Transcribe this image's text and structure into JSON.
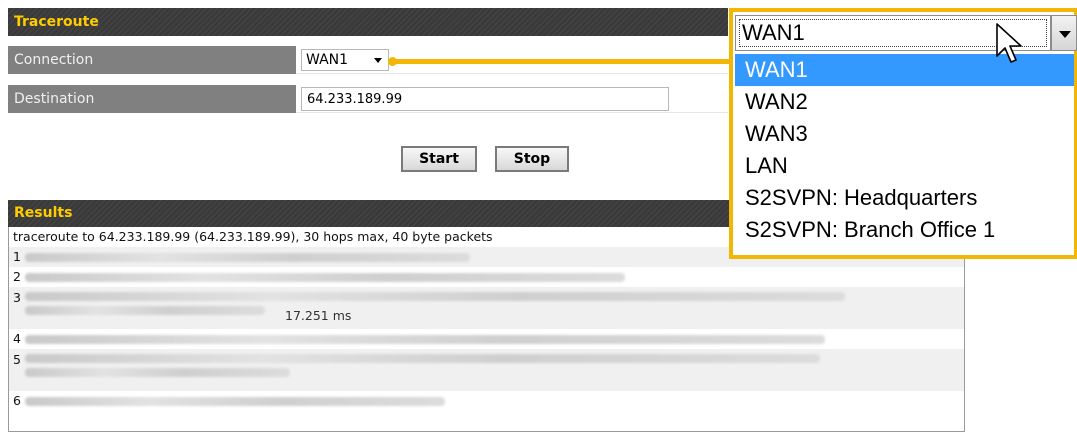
{
  "traceroute": {
    "title": "Traceroute",
    "connection_label": "Connection",
    "connection_value": "WAN1",
    "destination_label": "Destination",
    "destination_value": "64.233.189.99",
    "start_label": "Start",
    "stop_label": "Stop"
  },
  "results": {
    "title": "Results",
    "header_line": "traceroute to 64.233.189.99 (64.233.189.99), 30 hops max, 40 byte packets",
    "hops": [
      {
        "num": "1",
        "tail": ""
      },
      {
        "num": "2",
        "tail": ""
      },
      {
        "num": "3",
        "tail": "17.251 ms"
      },
      {
        "num": "4",
        "tail": ""
      },
      {
        "num": "5",
        "tail": ""
      },
      {
        "num": "6",
        "tail": ""
      }
    ]
  },
  "dropdown": {
    "current": "WAN1",
    "options": [
      "WAN1",
      "WAN2",
      "WAN3",
      "LAN",
      "S2SVPN: Headquarters",
      "S2SVPN: Branch Office 1"
    ],
    "selected_index": 0
  },
  "colors": {
    "accent": "#f2b705",
    "title_text": "#ffcc00",
    "selection": "#3399ff",
    "label_bg": "#808080"
  },
  "icons": [
    "dropdown-arrow-icon",
    "mouse-pointer-icon"
  ]
}
